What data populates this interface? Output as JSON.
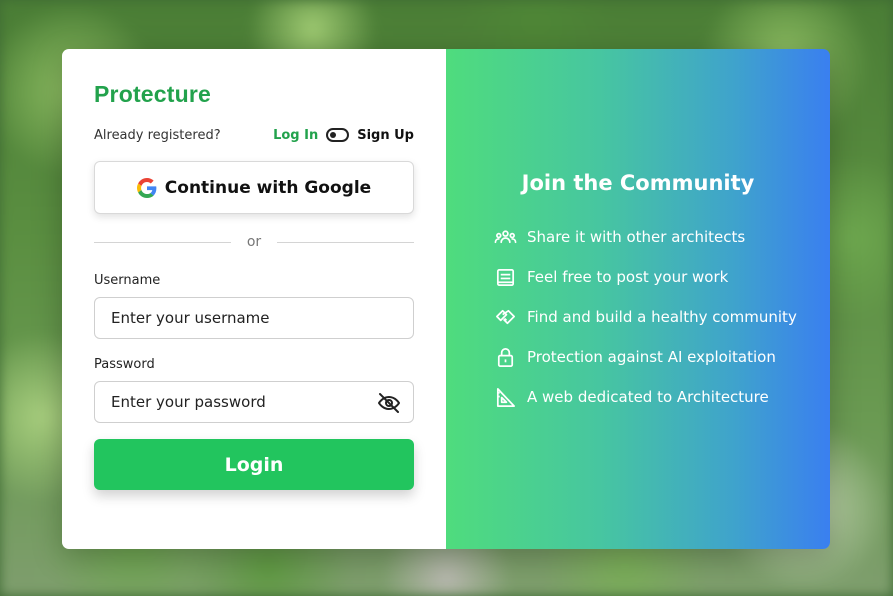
{
  "brand": {
    "name": "Protecture",
    "color": "#22a24c"
  },
  "auth_switch": {
    "prompt": "Already registered?",
    "login_label": "Log In",
    "signup_label": "Sign Up"
  },
  "google": {
    "label": "Continue with Google",
    "icon": "google-icon"
  },
  "divider": {
    "text": "or"
  },
  "username": {
    "label": "Username",
    "placeholder": "Enter your username",
    "value": ""
  },
  "password": {
    "label": "Password",
    "placeholder": "Enter your password",
    "value": "",
    "toggle_icon": "eye-off-icon"
  },
  "login_button": {
    "label": "Login",
    "color": "#22c55e"
  },
  "community": {
    "title": "Join the Community",
    "features": [
      {
        "icon": "users-icon",
        "text": "Share it with other architects"
      },
      {
        "icon": "document-icon",
        "text": "Feel free to post your work"
      },
      {
        "icon": "handshake-icon",
        "text": "Find and build a healthy community"
      },
      {
        "icon": "lock-icon",
        "text": "Protection against AI exploitation"
      },
      {
        "icon": "set-square-icon",
        "text": "A web dedicated to Architecture"
      }
    ]
  }
}
